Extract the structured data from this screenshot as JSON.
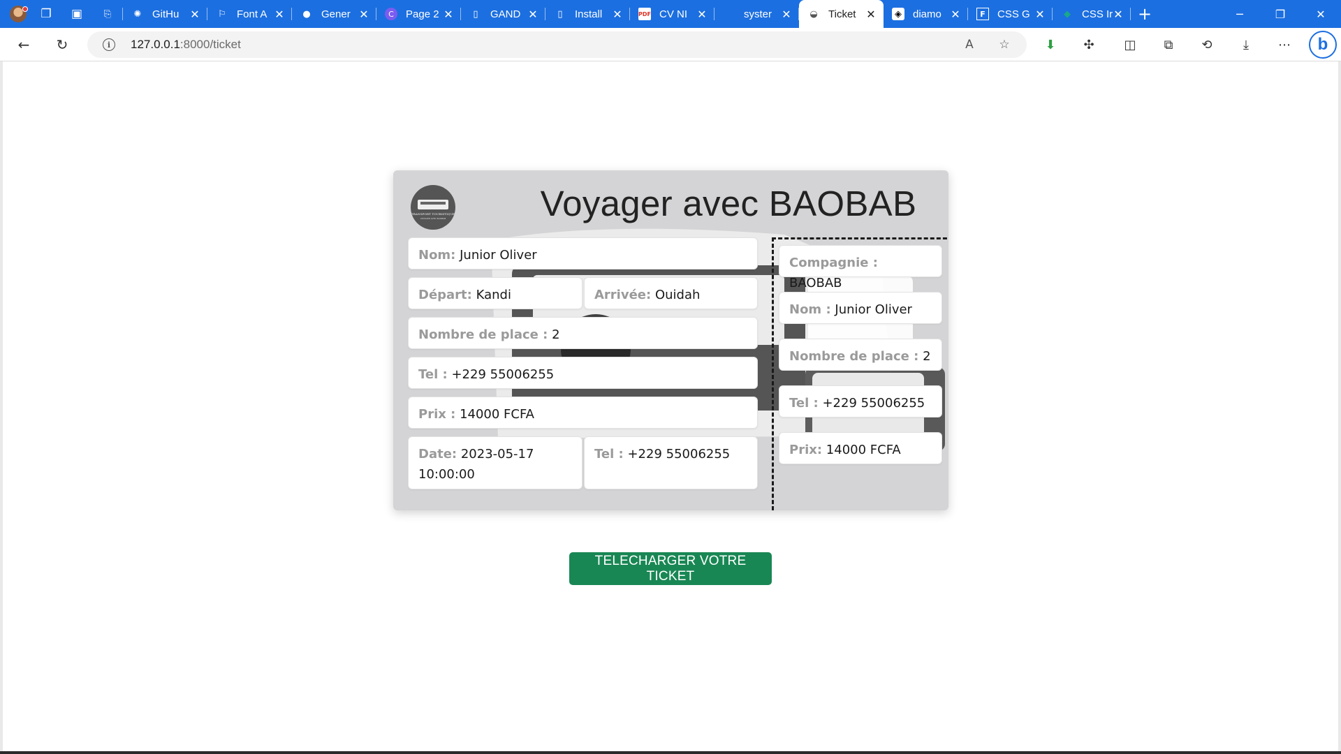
{
  "browser": {
    "tabs": [
      {
        "label": "GitHu",
        "icon": "chatgpt-icon"
      },
      {
        "label": "Font A",
        "icon": "flag-icon"
      },
      {
        "label": "Gener",
        "icon": "github-icon"
      },
      {
        "label": "Page 2",
        "icon": "canva-icon"
      },
      {
        "label": "GAND",
        "icon": "document-icon"
      },
      {
        "label": "Install",
        "icon": "document-icon"
      },
      {
        "label": "CV NI",
        "icon": "pdf-icon"
      },
      {
        "label": "syster",
        "icon": "blank-icon"
      },
      {
        "label": "Ticket",
        "icon": "globe-icon",
        "active": true
      },
      {
        "label": "diamo",
        "icon": "codepen-icon"
      },
      {
        "label": "CSS G",
        "icon": "f-icon"
      },
      {
        "label": "CSS Ir",
        "icon": "leaf-icon"
      }
    ],
    "url_host": "127.0.0.1",
    "url_path": ":8000/ticket"
  },
  "ticket": {
    "title": "Voyager avec BAOBAB",
    "logo_text": "TRANSPORT TOURISTIQUE",
    "logo_subtext": "VOYAGER AVEC BAOBAB",
    "main": {
      "nom_label": "Nom:",
      "nom_value": "Junior Oliver",
      "depart_label": "Départ:",
      "depart_value": "Kandi",
      "arrivee_label": "Arrivée:",
      "arrivee_value": "Ouidah",
      "places_label": "Nombre de place :",
      "places_value": "2",
      "tel_label": "Tel :",
      "tel_value": "+229 55006255",
      "prix_label": "Prix :",
      "prix_value": "14000 FCFA",
      "date_label": "Date:",
      "date_value": "2023-05-17 10:00:00",
      "tel2_label": "Tel :",
      "tel2_value": "+229 55006255"
    },
    "stub": {
      "compagnie_label": "Compagnie :",
      "compagnie_value": "BAOBAB",
      "nom_label": "Nom :",
      "nom_value": "Junior Oliver",
      "places_label": "Nombre de place :",
      "places_value": "2",
      "tel_label": "Tel :",
      "tel_value": "+229 55006255",
      "prix_label": "Prix:",
      "prix_value": "14000 FCFA"
    }
  },
  "download_label": "TELECHARGER VOTRE TICKET",
  "colors": {
    "tabbar": "#1c6fe0",
    "ticket_bg": "#d4d4d6",
    "button": "#198754"
  }
}
